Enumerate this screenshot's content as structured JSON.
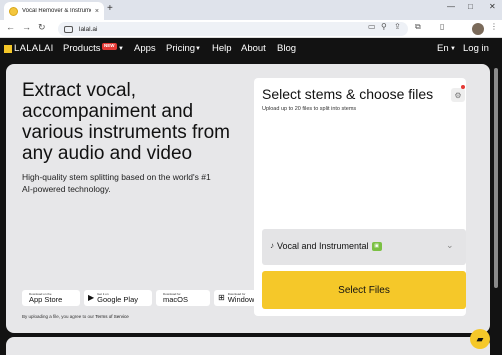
{
  "browser": {
    "tab_title": "Vocal Remover & Instrumenta",
    "tab_close": "×",
    "new_tab": "+",
    "url": "lalal.ai",
    "nav_back": "←",
    "nav_forward": "→",
    "nav_reload": "↻",
    "win_minimize": "—",
    "win_maximize": "□",
    "win_close": "✕"
  },
  "site_nav": {
    "logo_text": "LALALAI",
    "items": [
      {
        "label": "Products"
      },
      {
        "label": "Apps"
      },
      {
        "label": "Pricing"
      },
      {
        "label": "Help"
      },
      {
        "label": "About"
      },
      {
        "label": "Blog"
      }
    ],
    "products_badge": "NEW",
    "language": "En",
    "login": "Log in"
  },
  "hero": {
    "title": "Extract vocal, accompaniment and various instruments from any audio and video",
    "subtitle": "High-quality stem splitting based on the world's #1 AI-powered technology."
  },
  "stores": [
    {
      "small": "Download on the",
      "name": "App Store",
      "icon": ""
    },
    {
      "small": "Get it on",
      "name": "Google Play",
      "icon": "▶"
    },
    {
      "small": "Download for",
      "name": "macOS",
      "icon": ""
    },
    {
      "small": "Download for",
      "name": "Windows",
      "icon": "⊞"
    }
  ],
  "legal": {
    "prefix": "By uploading a file, you agree to our ",
    "link": "Terms of Service"
  },
  "upload": {
    "title": "Select stems & choose files",
    "subtitle": "Upload up to 20 files to split into stems",
    "stem_selection": "Vocal and Instrumental",
    "button": "Select Files"
  },
  "colors": {
    "accent": "#f5c829",
    "nav_bg": "#121212",
    "card_bg": "#e7e7e9",
    "badge_red": "#e53935"
  }
}
